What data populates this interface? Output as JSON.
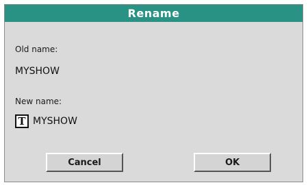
{
  "dialog": {
    "title": "Rename",
    "old_name_label": "Old name:",
    "old_name_value": "MYSHOW",
    "new_name_label": "New name:",
    "new_name_icon": "T",
    "new_name_value": "MYSHOW",
    "cancel_label": "Cancel",
    "ok_label": "OK"
  },
  "icons": {
    "text_edit": "text-edit-icon"
  },
  "colors": {
    "titlebar": "#2a9284",
    "dialog_background": "#dadada",
    "title_text": "#ffffff"
  }
}
